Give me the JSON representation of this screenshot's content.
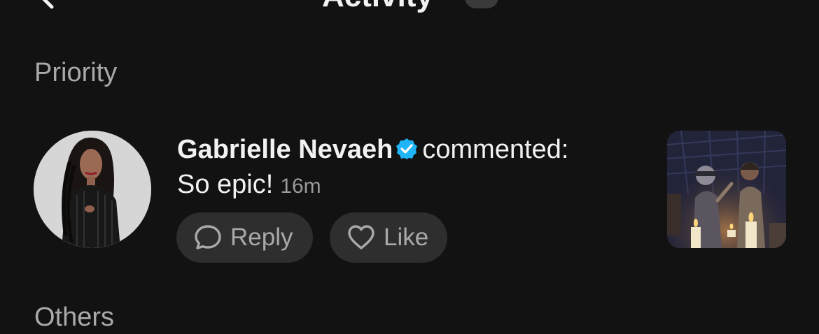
{
  "header": {
    "title": "Activity",
    "back_icon": "chevron-left-icon",
    "caret_icon": "chevron-down-icon"
  },
  "sections": {
    "priority_label": "Priority",
    "others_label": "Others"
  },
  "notification": {
    "username": "Gabrielle Nevaeh",
    "verified_icon": "verified-badge-icon",
    "action": "commented:",
    "comment": "So epic!",
    "time": "16m",
    "reply_label": "Reply",
    "like_label": "Like",
    "reply_icon": "speech-bubble-icon",
    "like_icon": "heart-icon"
  },
  "colors": {
    "background": "#121212",
    "pill": "#2e2e2e",
    "muted": "#a9a9a9",
    "verified": "#1fb4f5"
  }
}
